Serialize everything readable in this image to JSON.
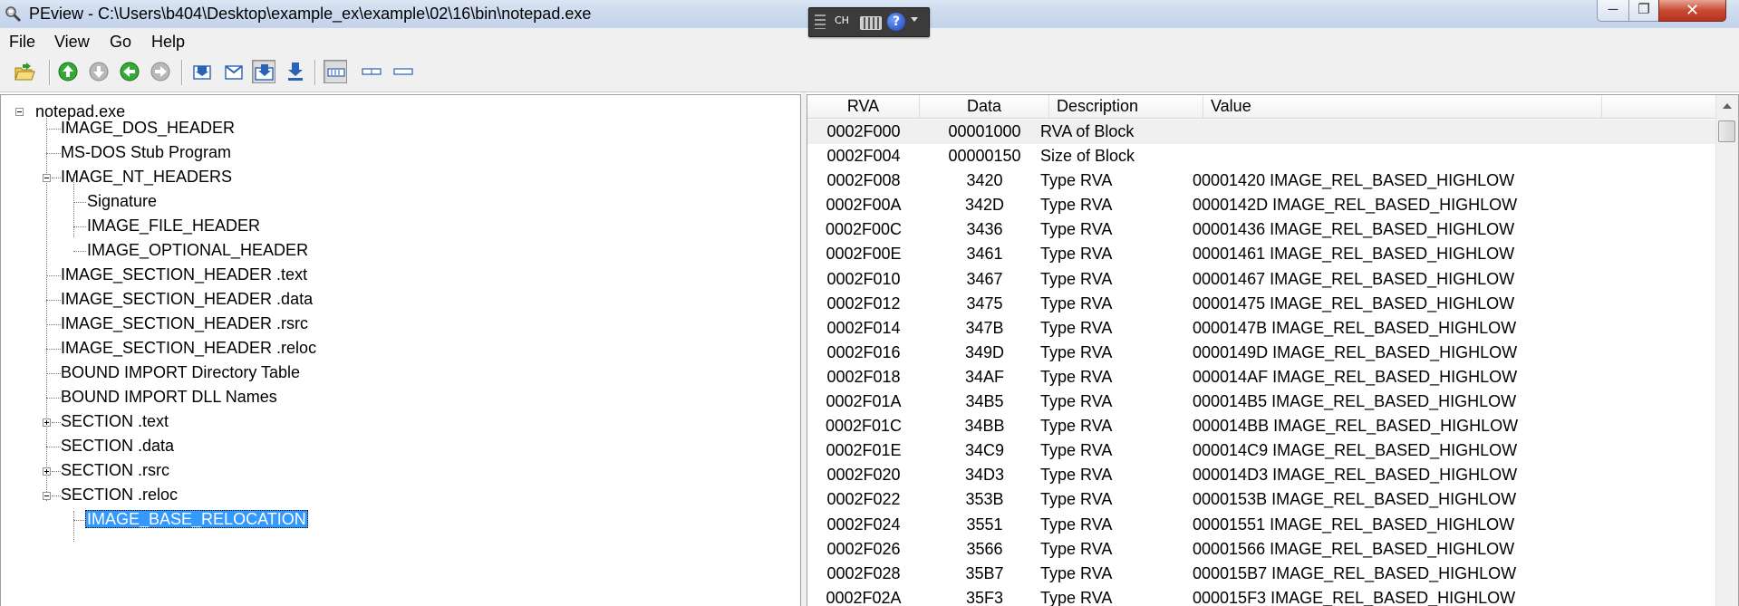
{
  "window": {
    "title": "PEview - C:\\Users\\b404\\Desktop\\example_ex\\example\\02\\16\\bin\\notepad.exe",
    "app_icon": "peview-magnifier-icon"
  },
  "language_bar": {
    "label": "CH",
    "help_glyph": "?"
  },
  "window_controls": {
    "minimize": "─",
    "maximize": "❐",
    "close": "✕"
  },
  "menu": {
    "file": "File",
    "view": "View",
    "go": "Go",
    "help": "Help"
  },
  "toolbar": {
    "icons": [
      "open-file-icon",
      "go-up-icon",
      "go-down-icon",
      "go-back-icon",
      "go-forward-icon",
      "view-byte-icon",
      "view-word-icon",
      "view-dword-icon",
      "view-qword-icon",
      "view-details-icon",
      "view-list-icon",
      "view-minimal-icon"
    ],
    "accent_color": "#2e9a2e"
  },
  "tree": {
    "root": "notepad.exe",
    "nodes": [
      {
        "label": "IMAGE_DOS_HEADER"
      },
      {
        "label": "MS-DOS Stub Program"
      },
      {
        "label": "IMAGE_NT_HEADERS"
      },
      {
        "label": "Signature"
      },
      {
        "label": "IMAGE_FILE_HEADER"
      },
      {
        "label": "IMAGE_OPTIONAL_HEADER"
      },
      {
        "label": "IMAGE_SECTION_HEADER .text"
      },
      {
        "label": "IMAGE_SECTION_HEADER .data"
      },
      {
        "label": "IMAGE_SECTION_HEADER .rsrc"
      },
      {
        "label": "IMAGE_SECTION_HEADER .reloc"
      },
      {
        "label": "BOUND IMPORT Directory Table"
      },
      {
        "label": "BOUND IMPORT DLL Names"
      },
      {
        "label": "SECTION .text"
      },
      {
        "label": "SECTION .data"
      },
      {
        "label": "SECTION .rsrc"
      },
      {
        "label": "SECTION .reloc"
      },
      {
        "label": "IMAGE_BASE_RELOCATION"
      }
    ],
    "selected": "IMAGE_BASE_RELOCATION",
    "selection_color": "#3399ff"
  },
  "list": {
    "columns": [
      "RVA",
      "Data",
      "Description",
      "Value"
    ],
    "rows": [
      {
        "rva": "0002F000",
        "data": "00001000",
        "desc": "RVA of Block",
        "value": ""
      },
      {
        "rva": "0002F004",
        "data": "00000150",
        "desc": "Size of Block",
        "value": ""
      },
      {
        "rva": "0002F008",
        "data": "3420",
        "desc": "Type RVA",
        "value": "00001420 IMAGE_REL_BASED_HIGHLOW"
      },
      {
        "rva": "0002F00A",
        "data": "342D",
        "desc": "Type RVA",
        "value": "0000142D IMAGE_REL_BASED_HIGHLOW"
      },
      {
        "rva": "0002F00C",
        "data": "3436",
        "desc": "Type RVA",
        "value": "00001436 IMAGE_REL_BASED_HIGHLOW"
      },
      {
        "rva": "0002F00E",
        "data": "3461",
        "desc": "Type RVA",
        "value": "00001461 IMAGE_REL_BASED_HIGHLOW"
      },
      {
        "rva": "0002F010",
        "data": "3467",
        "desc": "Type RVA",
        "value": "00001467 IMAGE_REL_BASED_HIGHLOW"
      },
      {
        "rva": "0002F012",
        "data": "3475",
        "desc": "Type RVA",
        "value": "00001475 IMAGE_REL_BASED_HIGHLOW"
      },
      {
        "rva": "0002F014",
        "data": "347B",
        "desc": "Type RVA",
        "value": "0000147B IMAGE_REL_BASED_HIGHLOW"
      },
      {
        "rva": "0002F016",
        "data": "349D",
        "desc": "Type RVA",
        "value": "0000149D IMAGE_REL_BASED_HIGHLOW"
      },
      {
        "rva": "0002F018",
        "data": "34AF",
        "desc": "Type RVA",
        "value": "000014AF IMAGE_REL_BASED_HIGHLOW"
      },
      {
        "rva": "0002F01A",
        "data": "34B5",
        "desc": "Type RVA",
        "value": "000014B5 IMAGE_REL_BASED_HIGHLOW"
      },
      {
        "rva": "0002F01C",
        "data": "34BB",
        "desc": "Type RVA",
        "value": "000014BB IMAGE_REL_BASED_HIGHLOW"
      },
      {
        "rva": "0002F01E",
        "data": "34C9",
        "desc": "Type RVA",
        "value": "000014C9 IMAGE_REL_BASED_HIGHLOW"
      },
      {
        "rva": "0002F020",
        "data": "34D3",
        "desc": "Type RVA",
        "value": "000014D3 IMAGE_REL_BASED_HIGHLOW"
      },
      {
        "rva": "0002F022",
        "data": "353B",
        "desc": "Type RVA",
        "value": "0000153B IMAGE_REL_BASED_HIGHLOW"
      },
      {
        "rva": "0002F024",
        "data": "3551",
        "desc": "Type RVA",
        "value": "00001551 IMAGE_REL_BASED_HIGHLOW"
      },
      {
        "rva": "0002F026",
        "data": "3566",
        "desc": "Type RVA",
        "value": "00001566 IMAGE_REL_BASED_HIGHLOW"
      },
      {
        "rva": "0002F028",
        "data": "35B7",
        "desc": "Type RVA",
        "value": "000015B7 IMAGE_REL_BASED_HIGHLOW"
      },
      {
        "rva": "0002F02A",
        "data": "35F3",
        "desc": "Type RVA",
        "value": "000015F3 IMAGE_REL_BASED_HIGHLOW"
      }
    ]
  }
}
